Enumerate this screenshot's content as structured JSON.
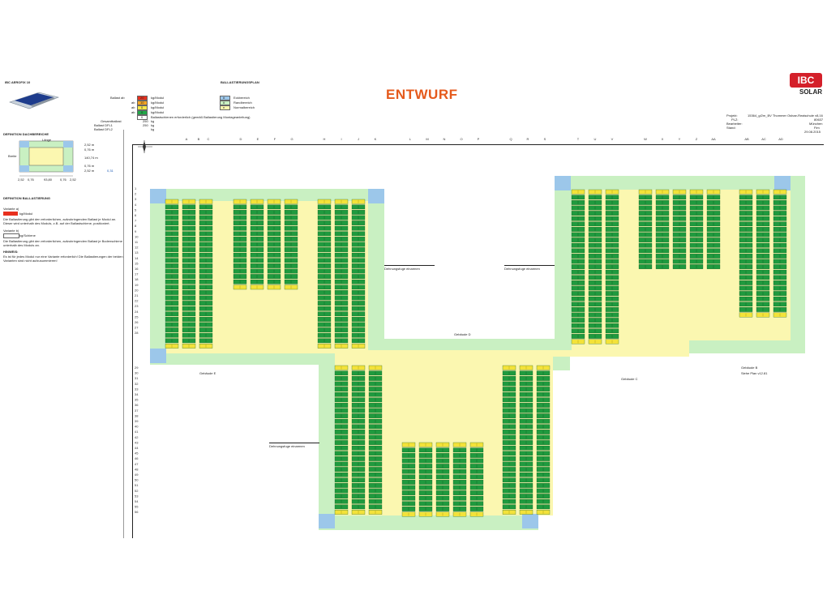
{
  "product": "IBC AEROFIX 10",
  "plan_title": "BALLASTIERUNGSPLAN",
  "watermark": "ENTWURF",
  "logo": {
    "brand": "IBC",
    "sub": "SOLAR",
    "color": "#d4202a"
  },
  "ballast_legend": {
    "row_label": "Ballast ab",
    "rows": [
      {
        "prefix": "Ballast ab",
        "value": "20",
        "unit": "kg/Modul",
        "color": "#e8301e"
      },
      {
        "prefix": "ab",
        "value": "10",
        "unit": "kg/Modul",
        "color": "#f5a623"
      },
      {
        "prefix": "ab",
        "value": "0",
        "unit": "kg/Modul",
        "color": "#f6e84a"
      },
      {
        "prefix": "ab",
        "value": "0",
        "unit": "kg/Modul",
        "color": "#21a848"
      },
      {
        "prefix": "",
        "value": "0",
        "unit": "Ballastschienen erforderlich (gemäß Ballastierung Montageanleitung)",
        "color": "#ffffff"
      }
    ],
    "zone_legend": [
      {
        "value": "#",
        "label": "Eckbereich",
        "color": "#9cc7ea"
      },
      {
        "value": "#",
        "label": "Randbereich",
        "color": "#c9f0c2"
      },
      {
        "value": "n",
        "label": "Normalbereich",
        "color": "#fbf7b0"
      }
    ],
    "totals": [
      {
        "label": "Gesamtballast",
        "value": "250",
        "unit": "kg"
      },
      {
        "label": "Ballast DFL1",
        "value": "250",
        "unit": "kg"
      },
      {
        "label": "Ballast DFL2",
        "value": "",
        "unit": "kg"
      }
    ]
  },
  "project_info": [
    {
      "label": "Projekt:",
      "value": "15364_g/2m_BV Thommer Oshae-Realschule v8,16"
    },
    {
      "label": "PLZ:",
      "value": "80637"
    },
    {
      "label": "Bearbeiter:",
      "value": "München"
    },
    {
      "label": "Stand:",
      "value": "Fim"
    },
    {
      "label": "",
      "value": "29.08.2015"
    }
  ],
  "def_dach": {
    "title": "DEFINITION DACHBEREICHE",
    "top_label": "Länge",
    "side_label": "Breite",
    "dims": [
      "2,52 m",
      "0,76 m",
      "140,74 m",
      "0,76 m",
      "2,52 m"
    ],
    "bottom_dims": [
      "2,52",
      "0,76",
      "93,80",
      "0,76",
      "2,52"
    ],
    "value": "0,31"
  },
  "def_ballast": {
    "title": "DEFINITION BALLASTIERUNG",
    "var_a": "Variante a)",
    "var_a_unit": "kg/Modul",
    "text_a": "Die Ballastierung gibt den erforderlichen, aufzubringenden Ballast je Modul an. Dieser wird unterhalb des Moduls, z.B. auf der Ballastschiene, positioniert.",
    "var_b": "Variante b)",
    "var_b_unit": "kg/Schiene",
    "text_b": "Die Ballastierung gibt den erforderlichen, aufzubringenden Ballast je Bodenschiene unterhalb des Moduls an.",
    "hint_title": "HINWEIS:",
    "hint_text": "Es ist für jedes Modul nur eine Variante erforderlich! Die Ballastierungen der beiden Varianten sind nicht aufzusummieren!"
  },
  "columns": [
    "A",
    "B",
    "C",
    "D",
    "E",
    "F",
    "G",
    "H",
    "I",
    "J",
    "K",
    "L",
    "M",
    "N",
    "O",
    "P",
    "Q",
    "R",
    "S",
    "T",
    "U",
    "V",
    "W",
    "X",
    "Y",
    "Z",
    "AA",
    "AB",
    "AC",
    "AD"
  ],
  "rows": [
    "1",
    "2",
    "3",
    "4",
    "5",
    "6",
    "7",
    "8",
    "9",
    "10",
    "11",
    "12",
    "13",
    "14",
    "15",
    "16",
    "17",
    "18",
    "19",
    "20",
    "21",
    "22",
    "23",
    "24",
    "25",
    "26",
    "27",
    "28",
    "29",
    "30",
    "31",
    "32",
    "33",
    "34",
    "35",
    "36",
    "37",
    "38",
    "39",
    "40",
    "41",
    "42",
    "43",
    "44",
    "45",
    "46",
    "47",
    "48",
    "49",
    "50",
    "51",
    "52",
    "53",
    "54",
    "55",
    "56"
  ],
  "plan_labels": {
    "gebaeude_d": "Gebäude D",
    "gebaeude_e": "Gebäude E",
    "gebaeude_c": "Gebäude C",
    "gebaeude_b": "Gebäude B",
    "plan_ref": "Siehe Plan v12.81",
    "dehn1": "Dehnungsfuge einarmen",
    "dehn2": "Dehnungsfuge einarmen",
    "dehn3": "Dehnungsfuge einarmen"
  },
  "module_colors": {
    "green": "#1f9a3e",
    "yellow": "#f3e23a",
    "edge": "#0d5a22"
  }
}
